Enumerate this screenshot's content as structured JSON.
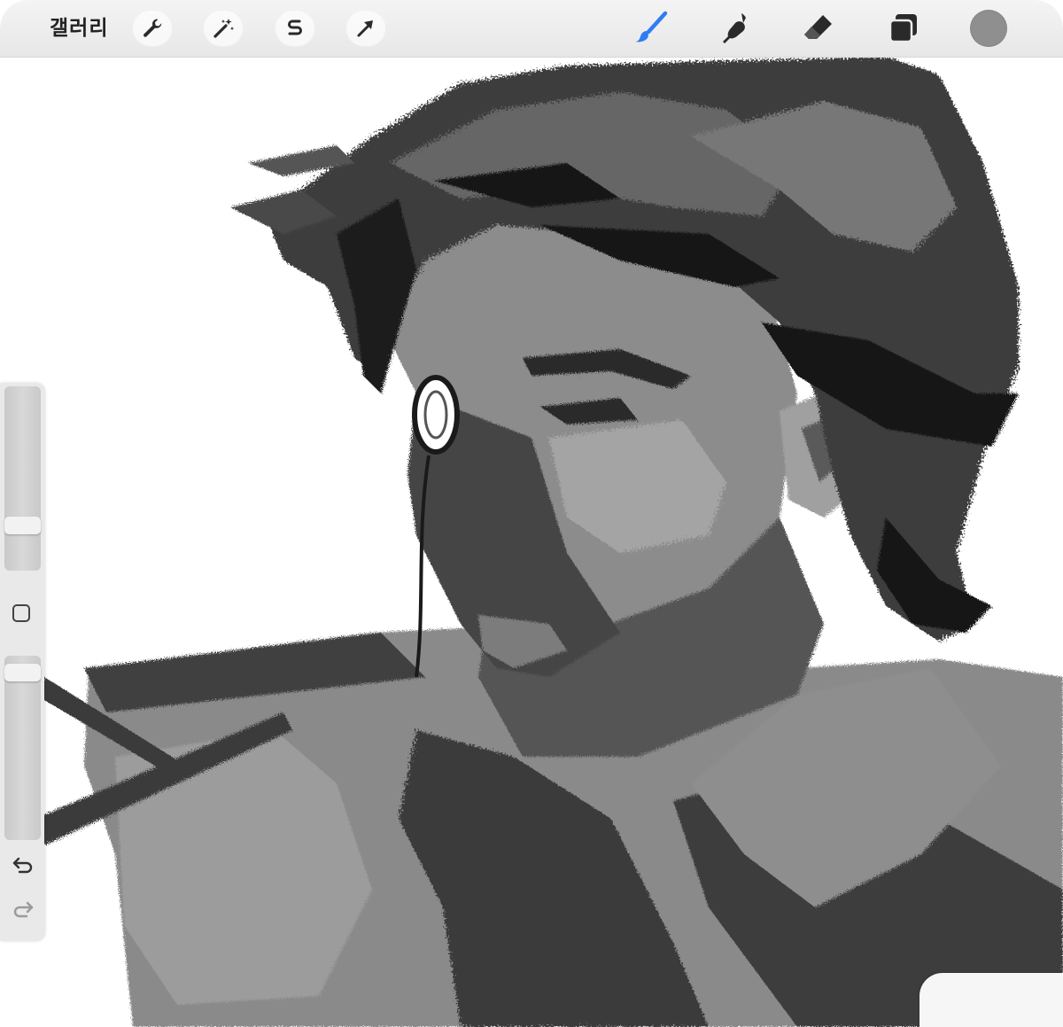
{
  "toolbar": {
    "gallery_label": "갤러리",
    "left_tools": [
      {
        "name": "wrench-icon"
      },
      {
        "name": "magic-wand-icon"
      },
      {
        "name": "selection-s-icon"
      },
      {
        "name": "transform-arrow-icon"
      }
    ],
    "right_tools": [
      {
        "name": "brush-icon",
        "active": true
      },
      {
        "name": "smudge-icon"
      },
      {
        "name": "eraser-icon"
      },
      {
        "name": "layers-icon"
      }
    ],
    "current_color": "#8f8f8f",
    "active_color": "#2f7cf6"
  },
  "sidebar": {
    "brush_size_level": 0.22,
    "opacity_level": 0.95
  },
  "canvas": {
    "subject": "grayscale-portrait-sketch"
  }
}
